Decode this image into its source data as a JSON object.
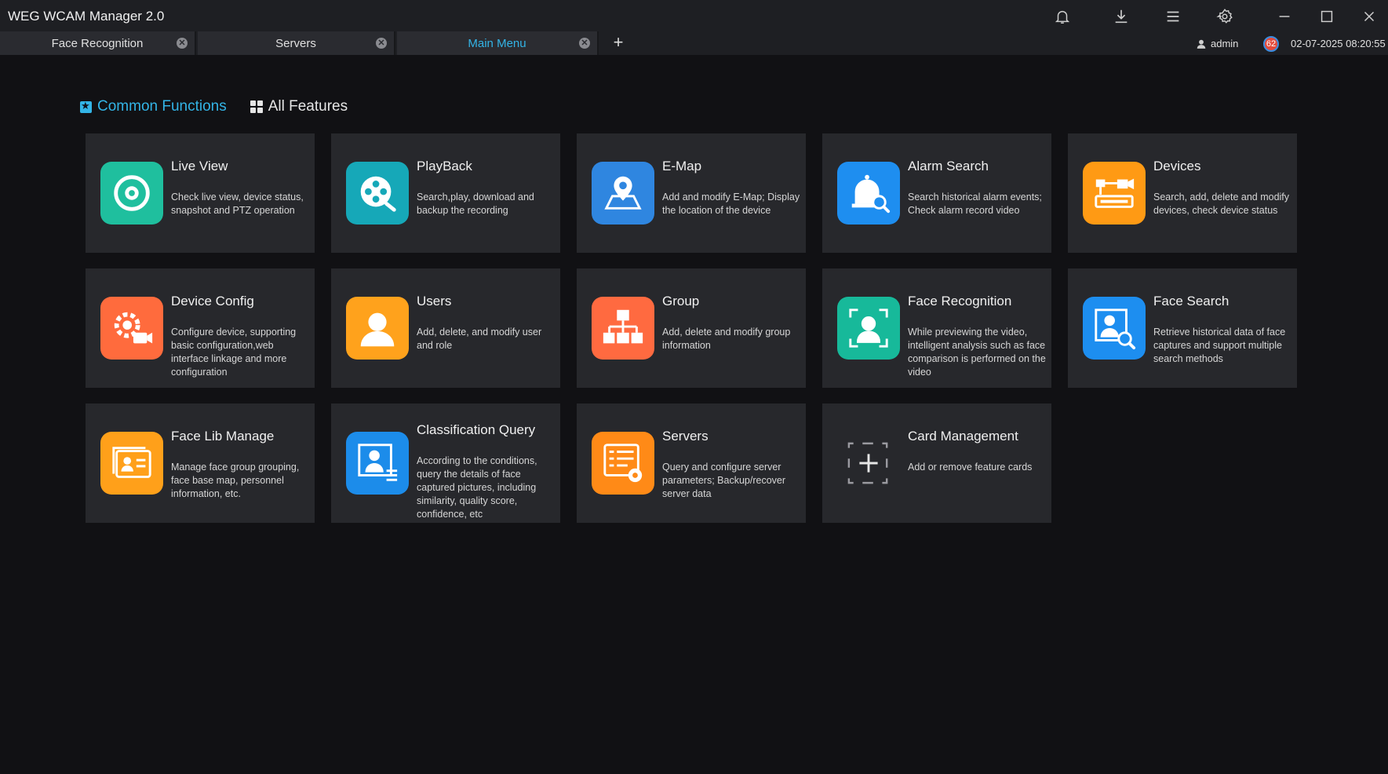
{
  "app": {
    "title": "WEG WCAM Manager 2.0"
  },
  "tabs": [
    {
      "label": "Face Recognition",
      "active": false
    },
    {
      "label": "Servers",
      "active": false
    },
    {
      "label": "Main Menu",
      "active": true
    }
  ],
  "titlebar_icons": [
    "bell-icon",
    "download-icon",
    "menu-icon",
    "settings-icon",
    "minimize-icon",
    "maximize-icon",
    "close-icon"
  ],
  "user": {
    "name": "admin",
    "notifications": "62",
    "datetime": "02-07-2025 08:20:55"
  },
  "sections": {
    "common": "Common Functions",
    "all": "All Features"
  },
  "colors": {
    "accent": "#33b4e6",
    "card_bg": "#27282c",
    "page_bg": "#111114"
  },
  "cards": [
    {
      "title": "Live View",
      "desc": "Check live view, device status, snapshot and PTZ operation",
      "icon": "live-view-icon",
      "color": "#1fbf9e"
    },
    {
      "title": "PlayBack",
      "desc": "Search,play, download and backup the recording",
      "icon": "playback-icon",
      "color": "#16a8b8"
    },
    {
      "title": "E-Map",
      "desc": "Add and modify E-Map; Display the location of the device",
      "icon": "emap-icon",
      "color": "#2f86e0"
    },
    {
      "title": "Alarm Search",
      "desc": "Search historical alarm events; Check alarm record video",
      "icon": "alarm-search-icon",
      "color": "#1e8ef0"
    },
    {
      "title": "Devices",
      "desc": "Search, add, delete and modify devices, check device status",
      "icon": "devices-icon",
      "color": "#ff9a14"
    },
    {
      "title": "Device Config",
      "desc": "Configure device, supporting basic configuration,web interface linkage and more configuration",
      "icon": "device-config-icon",
      "color": "#ff6b3d"
    },
    {
      "title": "Users",
      "desc": "Add, delete, and modify user and role",
      "icon": "users-icon",
      "color": "#ffa21c"
    },
    {
      "title": "Group",
      "desc": "Add, delete and modify group information",
      "icon": "group-icon",
      "color": "#ff6a40"
    },
    {
      "title": "Face Recognition",
      "desc": "While previewing the video, intelligent analysis such as face comparison is performed on the video",
      "icon": "face-recognition-icon",
      "color": "#17b99a"
    },
    {
      "title": "Face Search",
      "desc": "Retrieve historical data of face captures and support multiple search methods",
      "icon": "face-search-icon",
      "color": "#1d8ef0"
    },
    {
      "title": "Face Lib Manage",
      "desc": "Manage face group grouping, face base map, personnel information, etc.",
      "icon": "face-lib-icon",
      "color": "#ffa01a"
    },
    {
      "title": "Classification Query",
      "desc": "According to the conditions, query the details of face captured pictures, including similarity, quality score, confidence, etc",
      "icon": "classification-query-icon",
      "color": "#1c8cea"
    },
    {
      "title": "Servers",
      "desc": "Query and configure server parameters; Backup/recover server data",
      "icon": "servers-icon",
      "color": "#ff8a17"
    },
    {
      "title": "Card Management",
      "desc": "Add or remove feature cards",
      "icon": "card-management-icon",
      "color": "transparent"
    }
  ]
}
